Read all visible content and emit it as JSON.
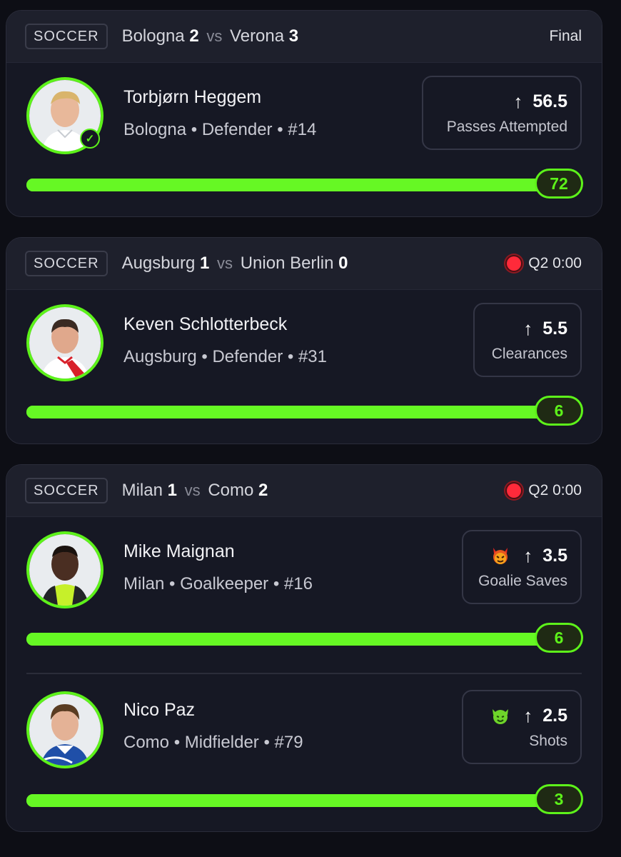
{
  "cards": [
    {
      "sport": "SOCCER",
      "team1": "Bologna",
      "score1": "2",
      "vs": "vs",
      "team2": "Verona",
      "score2": "3",
      "status": "Final",
      "live": false,
      "players": [
        {
          "name": "Torbjørn Heggem",
          "meta": "Bologna • Defender • #14",
          "line": "56.5",
          "stat": "Passes Attempted",
          "value": "72",
          "progress": 1.0,
          "icon": "up-arrow-icon",
          "badge": "check-icon"
        }
      ]
    },
    {
      "sport": "SOCCER",
      "team1": "Augsburg",
      "score1": "1",
      "vs": "vs",
      "team2": "Union Berlin",
      "score2": "0",
      "status": "Q2 0:00",
      "live": true,
      "players": [
        {
          "name": "Keven Schlotterbeck",
          "meta": "Augsburg • Defender • #31",
          "line": "5.5",
          "stat": "Clearances",
          "value": "6",
          "progress": 1.0,
          "icon": "up-arrow-icon"
        }
      ]
    },
    {
      "sport": "SOCCER",
      "team1": "Milan",
      "score1": "1",
      "vs": "vs",
      "team2": "Como",
      "score2": "2",
      "status": "Q2 0:00",
      "live": true,
      "players": [
        {
          "name": "Mike Maignan",
          "meta": "Milan • Goalkeeper • #16",
          "line": "3.5",
          "stat": "Goalie Saves",
          "value": "6",
          "progress": 1.0,
          "icon": "up-arrow-icon",
          "emoji": "devil-emoji-icon"
        },
        {
          "name": "Nico Paz",
          "meta": "Como • Midfielder • #79",
          "line": "2.5",
          "stat": "Shots",
          "value": "3",
          "progress": 1.0,
          "icon": "up-arrow-icon",
          "emoji": "goblin-emoji-icon"
        }
      ]
    }
  ],
  "colors": {
    "accent": "#5df21a",
    "live": "#ff2a3a",
    "background": "#0d0e15",
    "card": "#161824"
  }
}
